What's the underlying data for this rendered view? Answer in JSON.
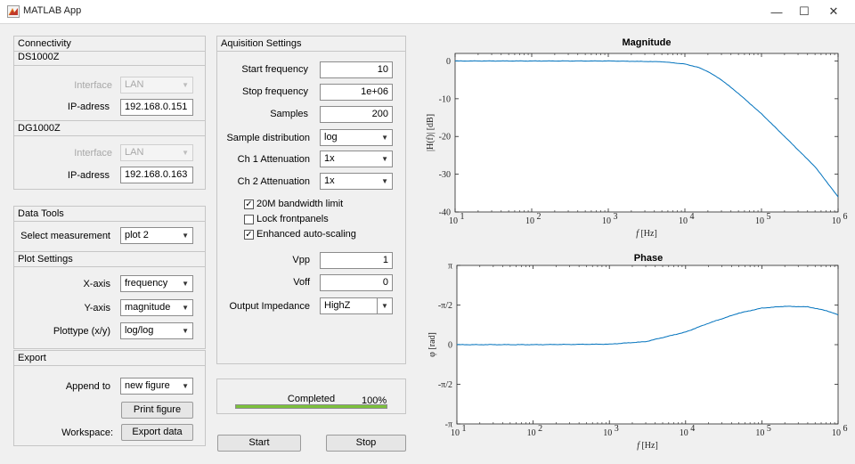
{
  "window": {
    "title": "MATLAB App",
    "minimize": "—",
    "maximize": "☐",
    "close": "✕"
  },
  "connectivity": {
    "title": "Connectivity",
    "ds": {
      "name": "DS1000Z",
      "interface_label": "Interface",
      "interface_value": "LAN",
      "ip_label": "IP-adress",
      "ip_value": "192.168.0.151"
    },
    "dg": {
      "name": "DG1000Z",
      "interface_label": "Interface",
      "interface_value": "LAN",
      "ip_label": "IP-adress",
      "ip_value": "192.168.0.163"
    }
  },
  "data_tools": {
    "title": "Data Tools",
    "select_label": "Select measurement",
    "select_value": "plot 2"
  },
  "plot_settings": {
    "title": "Plot Settings",
    "xaxis_label": "X-axis",
    "xaxis_value": "frequency",
    "yaxis_label": "Y-axis",
    "yaxis_value": "magnitude",
    "plottype_label": "Plottype (x/y)",
    "plottype_value": "log/log"
  },
  "export": {
    "title": "Export",
    "append_label": "Append to",
    "append_value": "new figure",
    "print_button": "Print figure",
    "workspace_label": "Workspace:",
    "export_button": "Export data"
  },
  "acquisition": {
    "title": "Aquisition Settings",
    "start_freq_label": "Start frequency",
    "start_freq_value": "10",
    "stop_freq_label": "Stop frequency",
    "stop_freq_value": "1e+06",
    "samples_label": "Samples",
    "samples_value": "200",
    "distribution_label": "Sample distribution",
    "distribution_value": "log",
    "ch1_label": "Ch 1 Attenuation",
    "ch1_value": "1x",
    "ch2_label": "Ch 2 Attenuation",
    "ch2_value": "1x",
    "bw_label": "20M bandwidth limit",
    "bw_checked": true,
    "lock_label": "Lock frontpanels",
    "lock_checked": false,
    "autoscale_label": "Enhanced auto-scaling",
    "autoscale_checked": true,
    "vpp_label": "Vpp",
    "vpp_value": "1",
    "voff_label": "Voff",
    "voff_value": "0",
    "impedance_label": "Output Impedance",
    "impedance_value": "HighZ"
  },
  "progress": {
    "status": "Completed",
    "percent_text": "100%",
    "fraction": 1.0,
    "color": "#7cc13b"
  },
  "controls": {
    "start_button": "Start",
    "stop_button": "Stop"
  },
  "magnitude_plot": {
    "title": "Magnitude",
    "xlabel_f": "f",
    "xlabel_unit": "[Hz]",
    "ylabel": "|H(f)| [dB]",
    "yticks": [
      "0",
      "-10",
      "-20",
      "-30",
      "-40"
    ],
    "xticks_base": [
      "10",
      "10",
      "10",
      "10",
      "10",
      "10"
    ],
    "xticks_exp": [
      "1",
      "2",
      "3",
      "4",
      "5",
      "6"
    ]
  },
  "phase_plot": {
    "title": "Phase",
    "xlabel_f": "f",
    "xlabel_unit": "[Hz]",
    "ylabel": "φ [rad]",
    "yticks": [
      "π",
      "-π/2",
      "0",
      "-π/2",
      "-π"
    ],
    "xticks_base": [
      "10",
      "10",
      "10",
      "10",
      "10",
      "10"
    ],
    "xticks_exp": [
      "1",
      "2",
      "3",
      "4",
      "5",
      "6"
    ]
  },
  "chart_data": [
    {
      "type": "line",
      "title": "Magnitude",
      "xlabel": "f [Hz]",
      "ylabel": "|H(f)| [dB]",
      "xscale": "log",
      "xlim": [
        10,
        1000000
      ],
      "ylim": [
        -40,
        2
      ],
      "grid": false,
      "series_color": "#0072bd",
      "x": [
        10,
        100,
        1000,
        5000,
        10000,
        15000,
        20000,
        30000,
        50000,
        100000,
        200000,
        500000,
        1000000
      ],
      "y": [
        0,
        0,
        0,
        -0.2,
        -0.8,
        -1.7,
        -2.8,
        -5.0,
        -8.6,
        -14.0,
        -20.0,
        -28.0,
        -36.0
      ]
    },
    {
      "type": "line",
      "title": "Phase",
      "xlabel": "f [Hz]",
      "ylabel": "φ [rad]",
      "xscale": "log",
      "xlim": [
        10,
        1000000
      ],
      "ylim": [
        -3.1416,
        3.1416
      ],
      "grid": false,
      "series_color": "#0072bd",
      "x": [
        10,
        100,
        1000,
        3000,
        10000,
        20000,
        50000,
        100000,
        200000,
        400000,
        700000,
        1000000
      ],
      "y": [
        0,
        0,
        0.02,
        0.12,
        0.5,
        0.85,
        1.25,
        1.45,
        1.52,
        1.5,
        1.35,
        1.18
      ]
    }
  ]
}
